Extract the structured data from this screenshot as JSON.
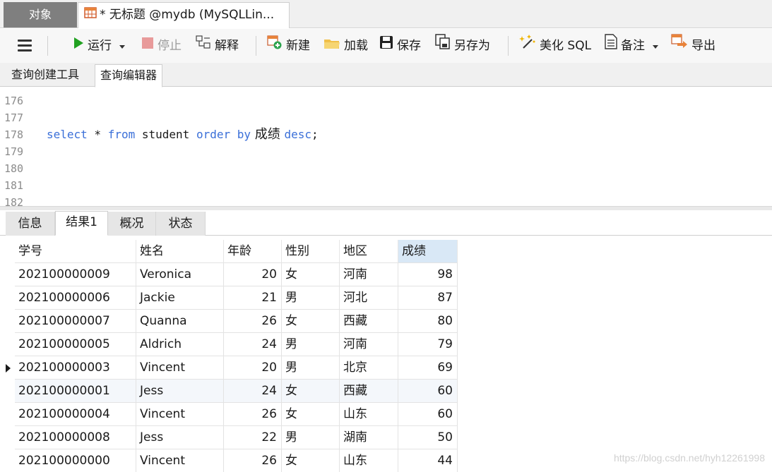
{
  "window_tabs": [
    {
      "label": "对象",
      "active": false
    },
    {
      "label": "* 无标题 @mydb (MySQLLin...",
      "active": true
    }
  ],
  "toolbar": {
    "run_label": "运行",
    "stop_label": "停止",
    "explain_label": "解释",
    "new_label": "新建",
    "load_label": "加载",
    "save_label": "保存",
    "save_as_label": "另存为",
    "beautify_label": "美化 SQL",
    "comment_label": "备注",
    "export_label": "导出"
  },
  "sub_tabs": [
    {
      "label": "查询创建工具",
      "active": false
    },
    {
      "label": "查询编辑器",
      "active": true
    }
  ],
  "editor": {
    "line_numbers": [
      "176",
      "177",
      "178",
      "179",
      "180",
      "181",
      "182"
    ],
    "code_line": {
      "kw_select": "select",
      "star": " * ",
      "kw_from": "from",
      "table": " student ",
      "kw_order_by": "order by",
      "column": " 成绩 ",
      "kw_desc": "desc",
      "end": ";"
    }
  },
  "result_tabs": [
    {
      "label": "信息",
      "active": false
    },
    {
      "label": "结果1",
      "active": true
    },
    {
      "label": "概况",
      "active": false
    },
    {
      "label": "状态",
      "active": false
    }
  ],
  "grid": {
    "columns": [
      "学号",
      "姓名",
      "年龄",
      "性别",
      "地区",
      "成绩"
    ],
    "sorted_column": "成绩",
    "rows": [
      [
        "202100000009",
        "Veronica",
        "20",
        "女",
        "河南",
        "98"
      ],
      [
        "202100000006",
        "Jackie",
        "21",
        "男",
        "河北",
        "87"
      ],
      [
        "202100000007",
        "Quanna",
        "26",
        "女",
        "西藏",
        "80"
      ],
      [
        "202100000005",
        "Aldrich",
        "24",
        "男",
        "河南",
        "79"
      ],
      [
        "202100000003",
        "Vincent",
        "20",
        "男",
        "北京",
        "69"
      ],
      [
        "202100000001",
        "Jess",
        "24",
        "女",
        "西藏",
        "60"
      ],
      [
        "202100000004",
        "Vincent",
        "26",
        "女",
        "山东",
        "60"
      ],
      [
        "202100000008",
        "Jess",
        "22",
        "男",
        "湖南",
        "50"
      ],
      [
        "202100000000",
        "Vincent",
        "26",
        "女",
        "山东",
        "44"
      ]
    ],
    "current_row": 4
  },
  "watermark": "https://blog.csdn.net/hyh12261998",
  "colors": {
    "keyword": "#3a6fd8",
    "run_icon": "#21a121",
    "stop_icon": "#e35b5b",
    "sorted_header": "#d9e8f6"
  },
  "icons": {
    "query_tab": "table-grid-icon",
    "menu": "hamburger-menu-icon",
    "run": "play-icon",
    "stop": "stop-square-icon",
    "explain": "explain-icon",
    "new": "new-query-icon",
    "load": "folder-icon",
    "save": "floppy-disk-icon",
    "save_as": "save-as-icon",
    "beautify": "magic-wand-icon",
    "comment": "note-icon",
    "export": "export-icon"
  }
}
